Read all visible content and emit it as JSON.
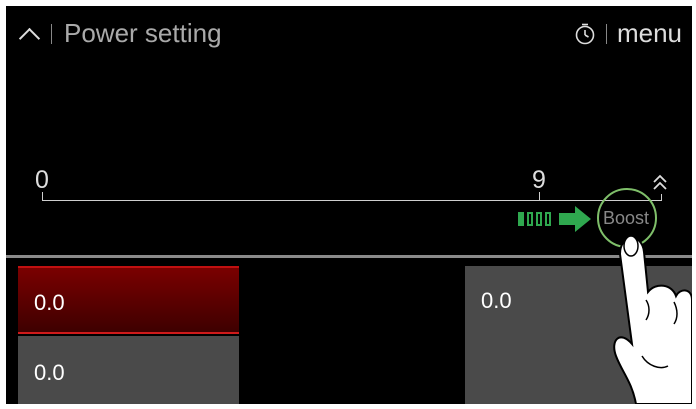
{
  "header": {
    "back_icon": "chevron-up-icon",
    "title": "Power setting",
    "timer_icon": "timer-icon",
    "menu_label": "menu"
  },
  "power_scale": {
    "min_label": "0",
    "max_label": "9",
    "boost_level_icon": "double-chevron-up-icon"
  },
  "boost": {
    "label": "Boost",
    "bars": 4,
    "arrow_icon": "right-arrow-icon",
    "accent_color": "#2fa84f"
  },
  "zones": {
    "active": {
      "value": "0.0",
      "color": "#7a0000"
    },
    "lower": {
      "value": "0.0"
    },
    "right": {
      "value": "0.0"
    }
  },
  "overlay": {
    "icon": "pointing-hand-icon"
  }
}
